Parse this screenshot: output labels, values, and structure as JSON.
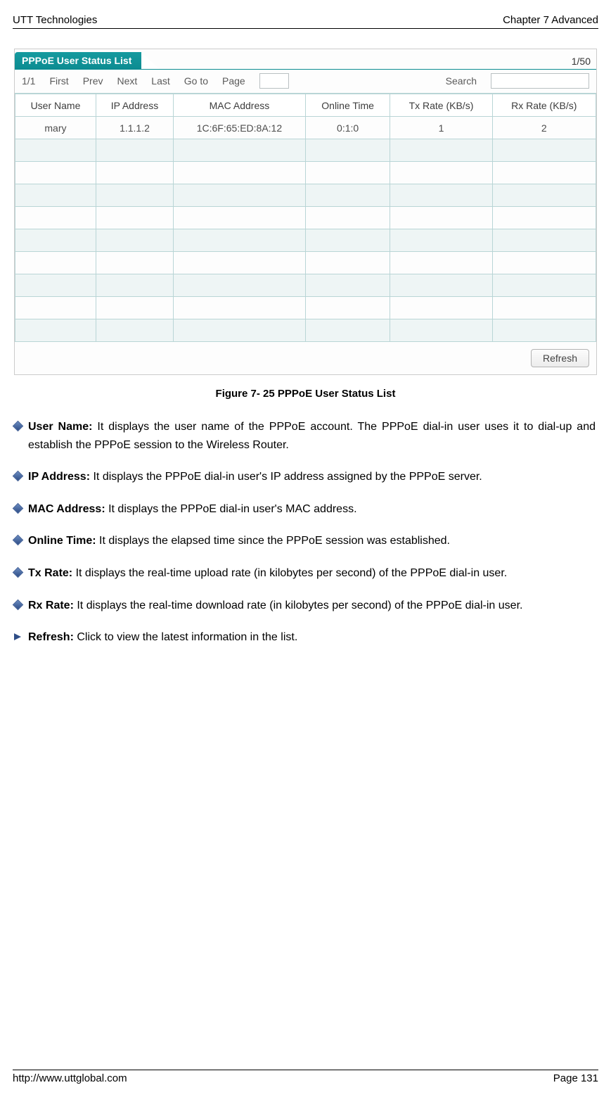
{
  "header": {
    "left": "UTT Technologies",
    "right": "Chapter 7 Advanced"
  },
  "panel": {
    "title": "PPPoE User Status List",
    "page_count": "1/50",
    "toolbar": {
      "pager": "1/1",
      "first": "First",
      "prev": "Prev",
      "next": "Next",
      "last": "Last",
      "goto": "Go to",
      "page_label": "Page",
      "search": "Search"
    },
    "columns": [
      "User Name",
      "IP Address",
      "MAC Address",
      "Online Time",
      "Tx Rate (KB/s)",
      "Rx Rate (KB/s)"
    ],
    "rows": [
      {
        "user": "mary",
        "ip": "1.1.1.2",
        "mac": "1C:6F:65:ED:8A:12",
        "online": "0:1:0",
        "tx": "1",
        "rx": "2"
      }
    ],
    "empty_row_count": 9,
    "refresh": "Refresh"
  },
  "caption": "Figure 7- 25 PPPoE User Status List",
  "descriptions": [
    {
      "term": "User Name:",
      "text": " It displays the user name of the PPPoE account. The PPPoE dial-in user uses it to dial-up and establish the PPPoE session to the Wireless Router."
    },
    {
      "term": "IP Address:",
      "text": " It displays the PPPoE dial-in user's IP address assigned by the PPPoE server."
    },
    {
      "term": "MAC Address:",
      "text": " It displays the PPPoE dial-in user's MAC address."
    },
    {
      "term": "Online Time:",
      "text": " It displays the elapsed time since the PPPoE session was established."
    },
    {
      "term": "Tx Rate:",
      "text": " It displays the real-time upload rate (in kilobytes per second) of the PPPoE dial-in user."
    },
    {
      "term": "Rx Rate:",
      "text": " It displays the real-time download rate (in kilobytes per second) of the PPPoE dial-in user."
    },
    {
      "term": "Refresh:",
      "text": " Click to view the latest information in the list.",
      "arrow": true
    }
  ],
  "footer": {
    "left": "http://www.uttglobal.com",
    "right": "Page 131"
  }
}
